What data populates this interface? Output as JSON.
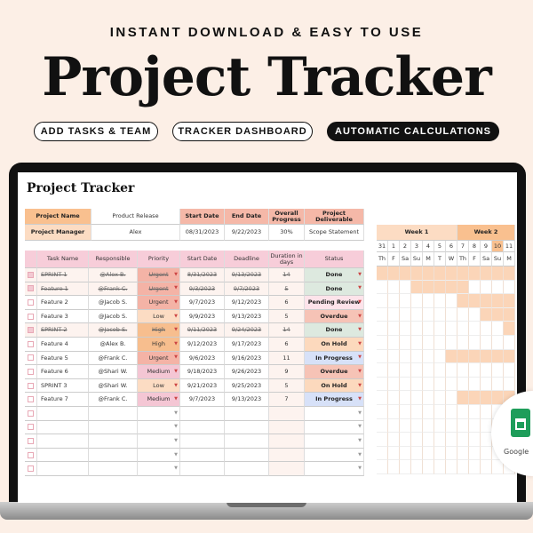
{
  "banner": {
    "subtitle": "INSTANT DOWNLOAD & EASY TO USE",
    "title": "Project Tracker",
    "features": [
      "ADD TASKS & TEAM",
      "TRACKER DASHBOARD",
      "AUTOMATIC CALCULATIONS"
    ]
  },
  "sheet": {
    "title": "Project Tracker",
    "info": {
      "project_name_label": "Project Name",
      "project_name": "Product Release",
      "manager_label": "Project Manager",
      "manager": "Alex",
      "start_label": "Start Date",
      "start": "08/31/2023",
      "end_label": "End Date",
      "end": "9/22/2023",
      "progress_label": "Overall Progress",
      "progress": "30%",
      "deliverable_label": "Project Deliverable",
      "deliverable": "Scope Statement"
    },
    "columns": [
      "Task Name",
      "Responsible",
      "Priority",
      "Start Date",
      "Deadline",
      "Duration in days",
      "Status"
    ],
    "tasks": [
      {
        "done": true,
        "name": "SPRINT 1",
        "who": "@Alex B.",
        "priority": "Urgent",
        "start": "8/31/2023",
        "deadline": "9/13/2023",
        "duration": "14",
        "status": "Done"
      },
      {
        "done": true,
        "name": "Feature 1",
        "who": "@Frank C.",
        "priority": "Urgent",
        "start": "9/3/2023",
        "deadline": "9/7/2023",
        "duration": "5",
        "status": "Done"
      },
      {
        "done": false,
        "name": "Feature 2",
        "who": "@Jacob S.",
        "priority": "Urgent",
        "start": "9/7/2023",
        "deadline": "9/12/2023",
        "duration": "6",
        "status": "Pending Review"
      },
      {
        "done": false,
        "name": "Feature 3",
        "who": "@Jacob S.",
        "priority": "Low",
        "start": "9/9/2023",
        "deadline": "9/13/2023",
        "duration": "5",
        "status": "Overdue"
      },
      {
        "done": true,
        "name": "SPRINT 2",
        "who": "@Jacob S.",
        "priority": "High",
        "start": "9/11/2023",
        "deadline": "9/24/2023",
        "duration": "14",
        "status": "Done"
      },
      {
        "done": false,
        "name": "Feature 4",
        "who": "@Alex B.",
        "priority": "High",
        "start": "9/12/2023",
        "deadline": "9/17/2023",
        "duration": "6",
        "status": "On Hold"
      },
      {
        "done": false,
        "name": "Feature 5",
        "who": "@Frank C.",
        "priority": "Urgent",
        "start": "9/6/2023",
        "deadline": "9/16/2023",
        "duration": "11",
        "status": "In Progress"
      },
      {
        "done": false,
        "name": "Feature 6",
        "who": "@Shari W.",
        "priority": "Medium",
        "start": "9/18/2023",
        "deadline": "9/26/2023",
        "duration": "9",
        "status": "Overdue"
      },
      {
        "done": false,
        "name": "SPRINT 3",
        "who": "@Shari W.",
        "priority": "Low",
        "start": "9/21/2023",
        "deadline": "9/25/2023",
        "duration": "5",
        "status": "On Hold"
      },
      {
        "done": false,
        "name": "Feature 7",
        "who": "@Frank C.",
        "priority": "Medium",
        "start": "9/7/2023",
        "deadline": "9/13/2023",
        "duration": "7",
        "status": "In Progress"
      }
    ],
    "empty_rows": 5,
    "priority_colors": {
      "Urgent": "#f4b3a6",
      "High": "#f7be8e",
      "Low": "#fcdcc3",
      "Medium": "#f4c6d4"
    },
    "status_colors": {
      "Done": "#dde9df",
      "Pending Review": "#fde3ea",
      "Overdue": "#f6c3b6",
      "On Hold": "#fcd9bd",
      "In Progress": "#d7e1f8"
    },
    "gantt": {
      "weeks": [
        "Week 1",
        "Week 2"
      ],
      "dates": [
        "31",
        "1",
        "2",
        "3",
        "4",
        "5",
        "6",
        "7",
        "8",
        "9",
        "10",
        "11"
      ],
      "days": [
        "Th",
        "F",
        "Sa",
        "Su",
        "M",
        "T",
        "W",
        "Th",
        "F",
        "Sa",
        "Su",
        "M"
      ],
      "bar_color": "#fbd5b8"
    }
  },
  "badge": {
    "label": "Google",
    "icon": "google-sheets-icon"
  }
}
